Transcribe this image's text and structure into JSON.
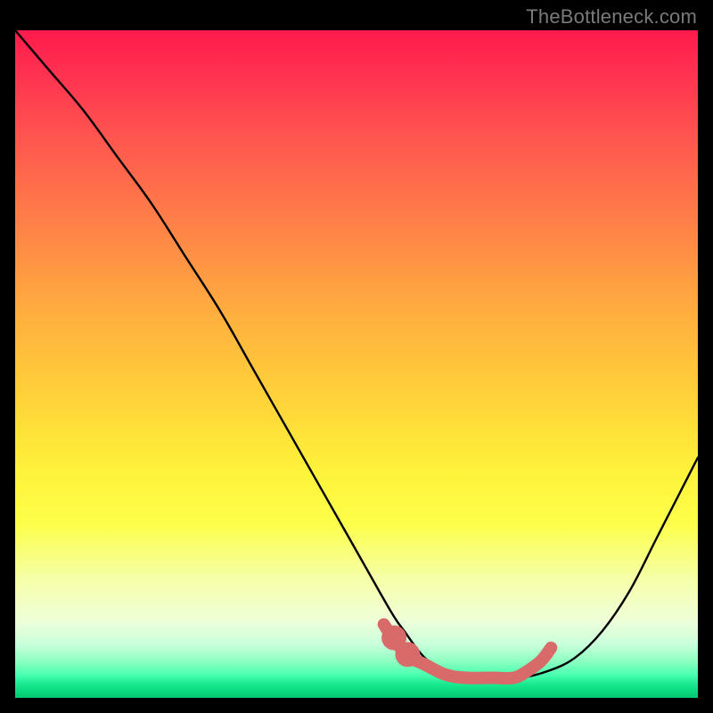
{
  "watermark": {
    "text": "TheBottleneck.com"
  },
  "chart_data": {
    "type": "line",
    "title": "",
    "xlabel": "",
    "ylabel": "",
    "xlim": [
      0,
      100
    ],
    "ylim": [
      0,
      100
    ],
    "grid": false,
    "series": [
      {
        "name": "bottleneck-curve",
        "color": "#000000",
        "x": [
          0,
          5,
          10,
          15,
          20,
          25,
          30,
          35,
          40,
          45,
          50,
          55,
          57,
          60,
          63,
          66,
          70,
          74,
          78,
          82,
          86,
          90,
          94,
          98,
          100
        ],
        "y": [
          100,
          94,
          88,
          81,
          74,
          66,
          58,
          49,
          40,
          31,
          22,
          13,
          10,
          6,
          4,
          3,
          3,
          3,
          4,
          6,
          10,
          16,
          24,
          32,
          36
        ]
      },
      {
        "name": "optimal-range-marker",
        "color": "#d86a6a",
        "x": [
          54,
          56,
          58,
          60,
          63,
          66,
          70,
          73,
          75,
          77,
          78.5
        ],
        "y": [
          11,
          8,
          6,
          5,
          3.5,
          3,
          3,
          3,
          4,
          5.5,
          7.5
        ]
      }
    ],
    "background_gradient": {
      "top": "#ff1a4d",
      "mid": "#fff23a",
      "bottom": "#02c86e"
    },
    "marker_shapes": [
      {
        "type": "dot",
        "x": 55.5,
        "y": 9,
        "r": 1.3
      },
      {
        "type": "dot",
        "x": 57.5,
        "y": 6.5,
        "r": 1.3
      }
    ]
  }
}
